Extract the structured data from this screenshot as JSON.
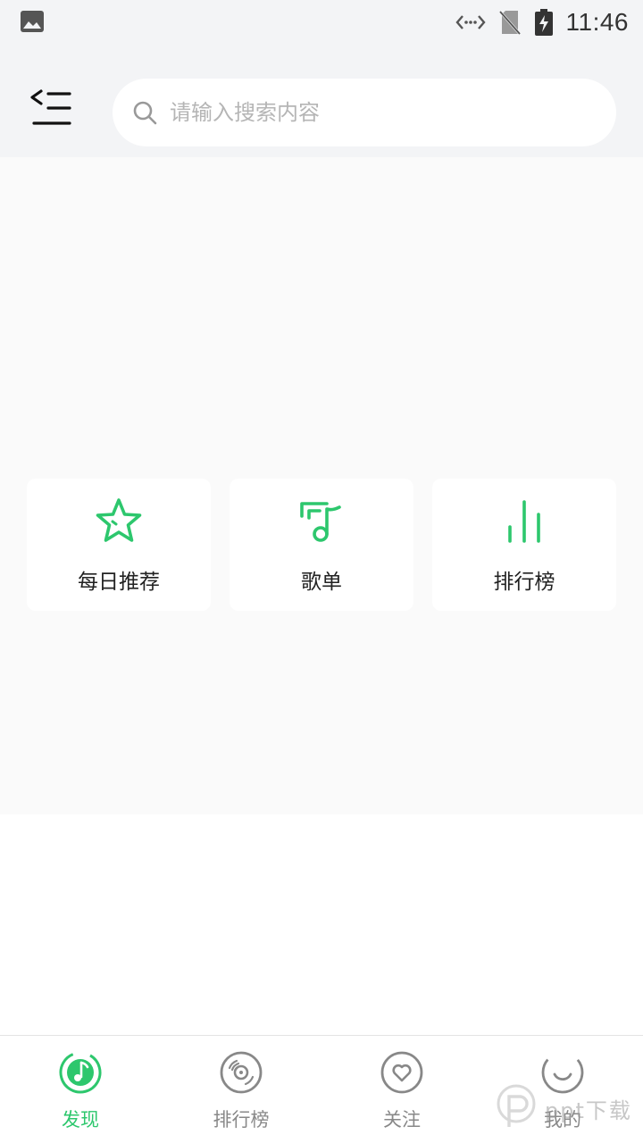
{
  "status_bar": {
    "time": "11:46",
    "icons": [
      "image-icon",
      "data-transfer-icon",
      "no-sim-icon",
      "battery-charging-icon"
    ]
  },
  "header": {
    "menu_icon": "menu-collapse-icon",
    "search": {
      "icon": "search-icon",
      "placeholder": "请输入搜索内容"
    }
  },
  "quick_entries": [
    {
      "label": "每日推荐",
      "icon": "star-icon"
    },
    {
      "label": "歌单",
      "icon": "playlist-icon"
    },
    {
      "label": "排行榜",
      "icon": "bars-icon"
    }
  ],
  "tabbar": {
    "tabs": [
      {
        "label": "发现",
        "icon": "music-disc-icon",
        "active": true
      },
      {
        "label": "排行榜",
        "icon": "vinyl-icon",
        "active": false
      },
      {
        "label": "关注",
        "icon": "heart-circle-icon",
        "active": false
      },
      {
        "label": "我的",
        "icon": "smile-circle-icon",
        "active": false
      }
    ]
  },
  "watermark": {
    "text": "ppt下载"
  },
  "colors": {
    "accent": "#2dc76d",
    "inactive": "#888888",
    "header_bg": "#f3f4f6",
    "content_bg": "#fafafa"
  }
}
